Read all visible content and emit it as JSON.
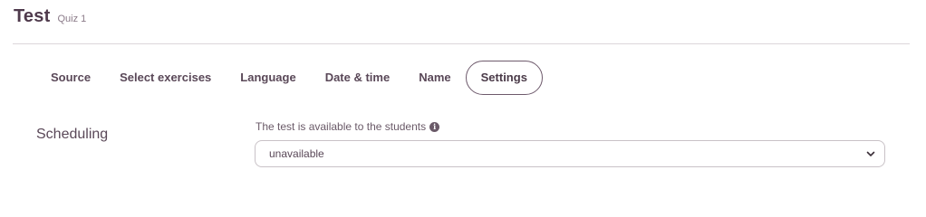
{
  "header": {
    "title": "Test",
    "subtitle": "Quiz 1"
  },
  "tabs": [
    {
      "label": "Source",
      "active": false
    },
    {
      "label": "Select exercises",
      "active": false
    },
    {
      "label": "Language",
      "active": false
    },
    {
      "label": "Date & time",
      "active": false
    },
    {
      "label": "Name",
      "active": false
    },
    {
      "label": "Settings",
      "active": true
    }
  ],
  "settings": {
    "section_label": "Scheduling",
    "availability": {
      "label": "The test is available to the students",
      "info_icon": "info-circle-icon",
      "selected": "unavailable",
      "dropdown_icon": "chevron-down-icon"
    }
  },
  "colors": {
    "text": "#4a3a48",
    "divider": "#dcd6da",
    "active_tab_border": "#6e5a6c"
  }
}
